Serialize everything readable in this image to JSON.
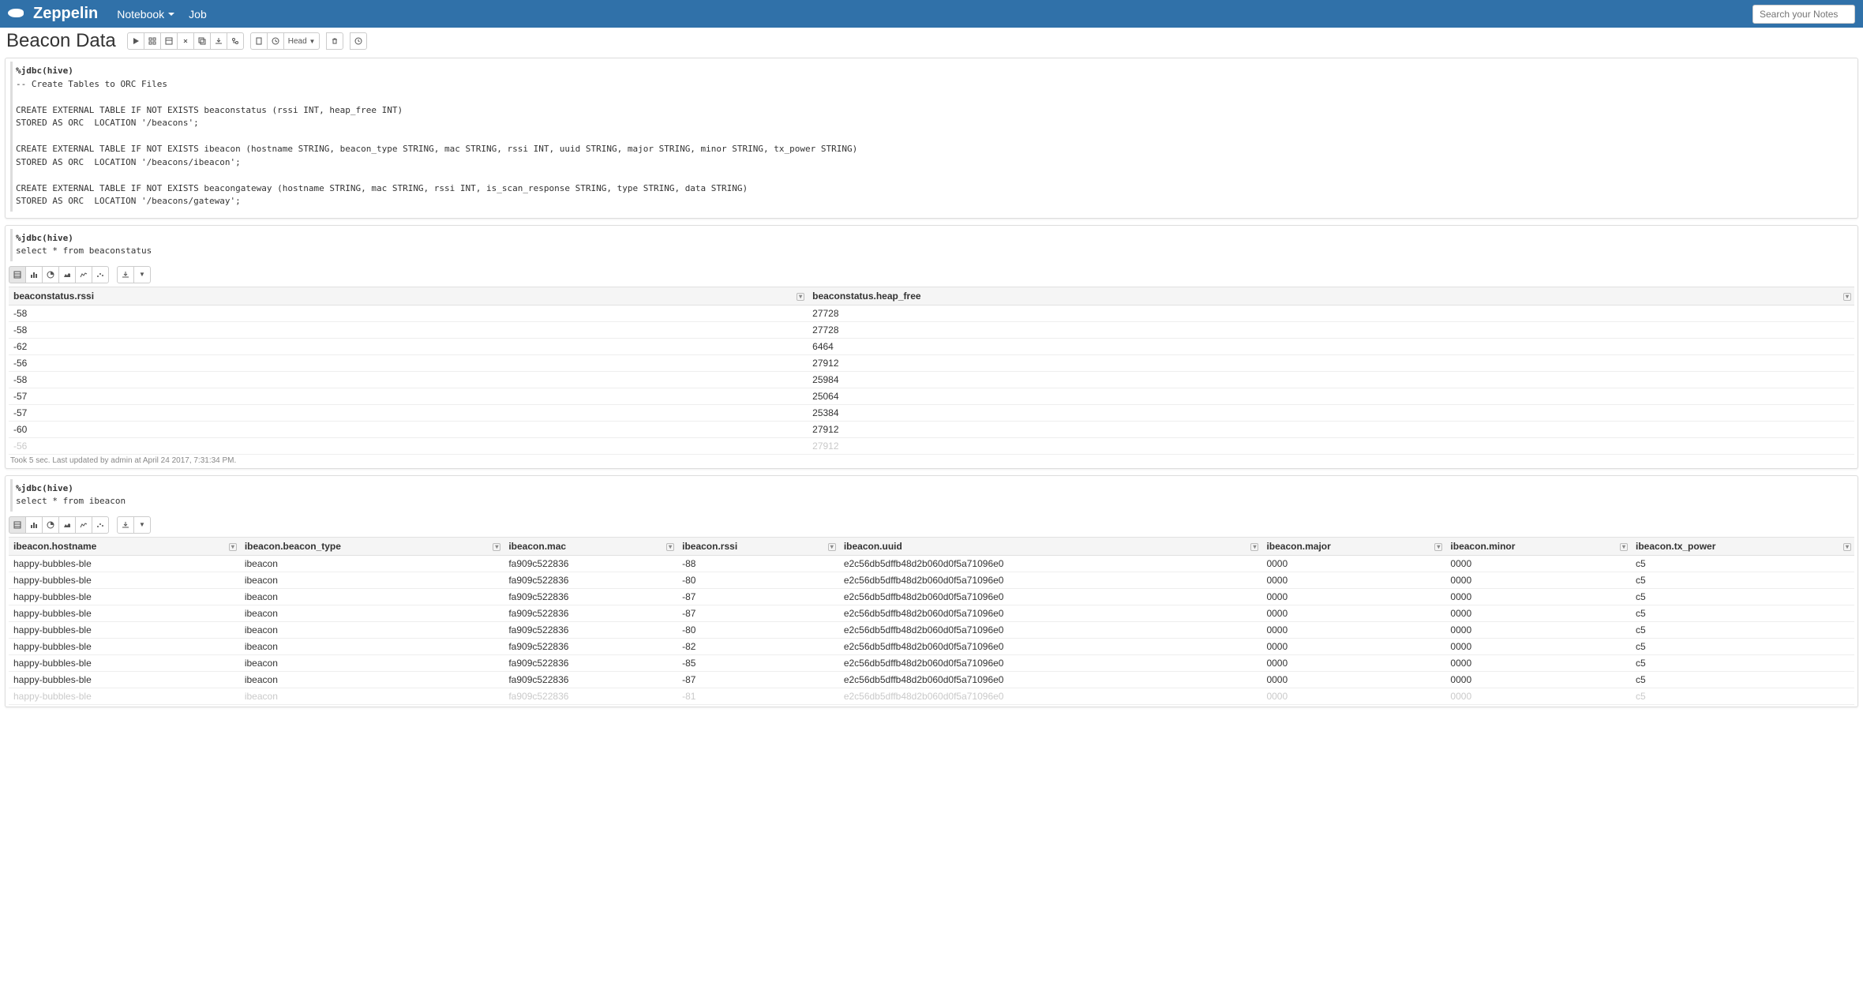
{
  "nav": {
    "brand": "Zeppelin",
    "items": [
      "Notebook",
      "Job"
    ],
    "search_placeholder": "Search your Notes"
  },
  "title": "Beacon Data",
  "toolbar": {
    "head_label": "Head"
  },
  "paragraphs": [
    {
      "interpreter": "%jdbc(hive)",
      "code": "\n-- Create Tables to ORC Files\n\nCREATE EXTERNAL TABLE IF NOT EXISTS beaconstatus (rssi INT, heap_free INT)\nSTORED AS ORC  LOCATION '/beacons';\n\nCREATE EXTERNAL TABLE IF NOT EXISTS ibeacon (hostname STRING, beacon_type STRING, mac STRING, rssi INT, uuid STRING, major STRING, minor STRING, tx_power STRING)\nSTORED AS ORC  LOCATION '/beacons/ibeacon';\n\nCREATE EXTERNAL TABLE IF NOT EXISTS beacongateway (hostname STRING, mac STRING, rssi INT, is_scan_response STRING, type STRING, data STRING)\nSTORED AS ORC  LOCATION '/beacons/gateway';"
    },
    {
      "interpreter": "%jdbc(hive)",
      "code": "\nselect * from beaconstatus",
      "columns": [
        "beaconstatus.rssi",
        "beaconstatus.heap_free"
      ],
      "rows": [
        [
          "-58",
          "27728"
        ],
        [
          "-58",
          "27728"
        ],
        [
          "-62",
          "6464"
        ],
        [
          "-56",
          "27912"
        ],
        [
          "-58",
          "25984"
        ],
        [
          "-57",
          "25064"
        ],
        [
          "-57",
          "25384"
        ],
        [
          "-60",
          "27912"
        ]
      ],
      "fade_row": [
        "-56",
        "27912"
      ],
      "footer": "Took 5 sec. Last updated by admin at April 24 2017, 7:31:34 PM."
    },
    {
      "interpreter": "%jdbc(hive)",
      "code": "\nselect * from ibeacon",
      "columns": [
        "ibeacon.hostname",
        "ibeacon.beacon_type",
        "ibeacon.mac",
        "ibeacon.rssi",
        "ibeacon.uuid",
        "ibeacon.major",
        "ibeacon.minor",
        "ibeacon.tx_power"
      ],
      "rows": [
        [
          "happy-bubbles-ble",
          "ibeacon",
          "fa909c522836",
          "-88",
          "e2c56db5dffb48d2b060d0f5a71096e0",
          "0000",
          "0000",
          "c5"
        ],
        [
          "happy-bubbles-ble",
          "ibeacon",
          "fa909c522836",
          "-80",
          "e2c56db5dffb48d2b060d0f5a71096e0",
          "0000",
          "0000",
          "c5"
        ],
        [
          "happy-bubbles-ble",
          "ibeacon",
          "fa909c522836",
          "-87",
          "e2c56db5dffb48d2b060d0f5a71096e0",
          "0000",
          "0000",
          "c5"
        ],
        [
          "happy-bubbles-ble",
          "ibeacon",
          "fa909c522836",
          "-87",
          "e2c56db5dffb48d2b060d0f5a71096e0",
          "0000",
          "0000",
          "c5"
        ],
        [
          "happy-bubbles-ble",
          "ibeacon",
          "fa909c522836",
          "-80",
          "e2c56db5dffb48d2b060d0f5a71096e0",
          "0000",
          "0000",
          "c5"
        ],
        [
          "happy-bubbles-ble",
          "ibeacon",
          "fa909c522836",
          "-82",
          "e2c56db5dffb48d2b060d0f5a71096e0",
          "0000",
          "0000",
          "c5"
        ],
        [
          "happy-bubbles-ble",
          "ibeacon",
          "fa909c522836",
          "-85",
          "e2c56db5dffb48d2b060d0f5a71096e0",
          "0000",
          "0000",
          "c5"
        ],
        [
          "happy-bubbles-ble",
          "ibeacon",
          "fa909c522836",
          "-87",
          "e2c56db5dffb48d2b060d0f5a71096e0",
          "0000",
          "0000",
          "c5"
        ]
      ],
      "fade_row": [
        "happy-bubbles-ble",
        "ibeacon",
        "fa909c522836",
        "-81",
        "e2c56db5dffb48d2b060d0f5a71096e0",
        "0000",
        "0000",
        "c5"
      ]
    }
  ]
}
